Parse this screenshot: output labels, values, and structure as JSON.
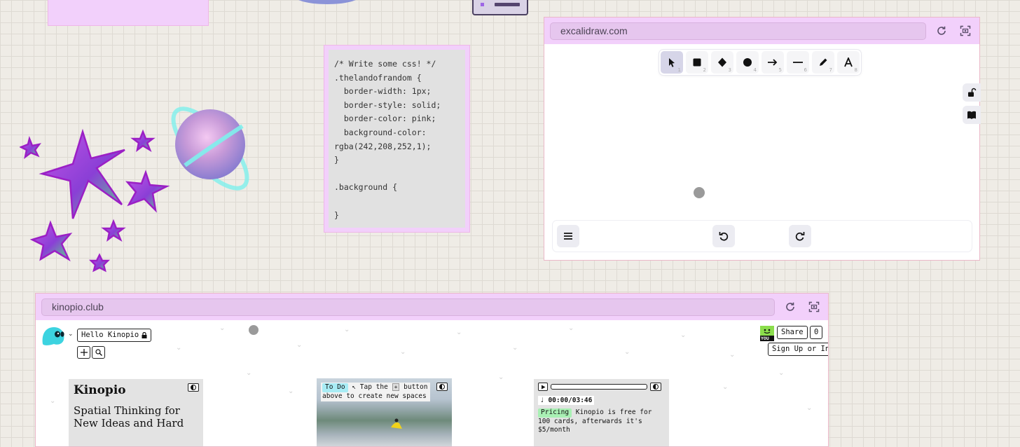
{
  "excalidraw": {
    "url": "excalidraw.com",
    "tools": [
      {
        "name": "selection",
        "key": "1"
      },
      {
        "name": "rectangle",
        "key": "2"
      },
      {
        "name": "diamond",
        "key": "3"
      },
      {
        "name": "ellipse",
        "key": "4"
      },
      {
        "name": "arrow",
        "key": "5"
      },
      {
        "name": "line",
        "key": "6"
      },
      {
        "name": "draw",
        "key": "7"
      },
      {
        "name": "text",
        "key": "8"
      }
    ]
  },
  "css_card": {
    "code": "/* Write some css! */\n.thelandofrandom {\n  border-width: 1px;\n  border-style: solid;\n  border-color: pink;\n  background-color:\nrgba(242,208,252,1);\n}\n\n.background {\n\n}"
  },
  "kinopio": {
    "url": "kinopio.club",
    "space_name": "Hello Kinopio",
    "share_label": "Share",
    "share_count": "0",
    "you_label": "YOU",
    "signup_label": "Sign Up or In",
    "card_title": {
      "title": "Kinopio",
      "subtitle": "Spatial Thinking for New Ideas and Hard"
    },
    "card_todo": {
      "tag": "To Do",
      "text_1": "↖ Tap the",
      "plus": "+",
      "text_2": "button",
      "text_3": "above to create new spaces"
    },
    "card_pricing": {
      "time": "♩ 00:00/03:46",
      "tag": "Pricing",
      "text": "Kinopio is free for 100 cards, afterwards it's $5/month"
    }
  },
  "colors": {
    "card_pink": "#f2d0fb",
    "card_border": "#eeb6e8",
    "todo_tag": "#a8ecf5",
    "pricing_tag": "#a9f0b4"
  }
}
